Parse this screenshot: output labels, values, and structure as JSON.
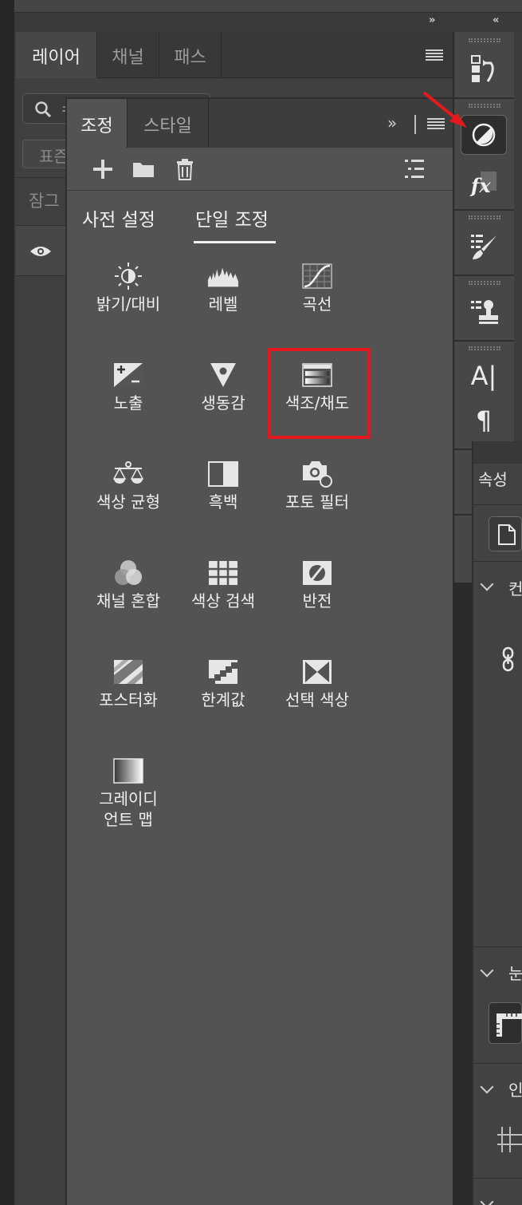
{
  "layers_panel": {
    "tabs": [
      "레이어",
      "채널",
      "패스"
    ],
    "search_partial": "ㅋ",
    "mode_partial": "표즌",
    "lock_partial": "잠그"
  },
  "top_collapse_glyph": "»",
  "adjustments_panel": {
    "tabs": [
      "조정",
      "스타일"
    ],
    "expand_glyph": "»",
    "subtabs": [
      "사전 설정",
      "단일 조정"
    ],
    "active_subtab": "단일 조정",
    "items": [
      {
        "label": "밝기/대비",
        "icon": "brightness-contrast-icon"
      },
      {
        "label": "레벨",
        "icon": "levels-icon"
      },
      {
        "label": "곡선",
        "icon": "curves-icon"
      },
      {
        "label": "노출",
        "icon": "exposure-icon"
      },
      {
        "label": "생동감",
        "icon": "vibrance-icon"
      },
      {
        "label": "색조/채도",
        "icon": "hue-saturation-icon"
      },
      {
        "label": "색상 균형",
        "icon": "color-balance-icon"
      },
      {
        "label": "흑백",
        "icon": "black-white-icon"
      },
      {
        "label": "포토 필터",
        "icon": "photo-filter-icon"
      },
      {
        "label": "채널 혼합",
        "icon": "channel-mixer-icon"
      },
      {
        "label": "색상 검색",
        "icon": "color-lookup-icon"
      },
      {
        "label": "반전",
        "icon": "invert-icon"
      },
      {
        "label": "포스터화",
        "icon": "posterize-icon"
      },
      {
        "label": "한계값",
        "icon": "threshold-icon"
      },
      {
        "label": "선택 색상",
        "icon": "selective-color-icon"
      },
      {
        "label": "그레이디\n언트 맵",
        "icon": "gradient-map-icon"
      }
    ],
    "highlighted_item": "색조/채도",
    "highlight_color": "#e5181d"
  },
  "toolstrip": {
    "collapse_glyph": "«",
    "tools": [
      "history-icon",
      "adjustments-icon",
      "styles-fx-icon",
      "brush-presets-icon",
      "clone-source-icon",
      "character-icon",
      "paragraph-icon"
    ],
    "character_label": "A|",
    "paragraph_label": "¶"
  },
  "properties_panel": {
    "tab_partial": "속성",
    "sections": [
      "컨",
      "눈",
      "인"
    ]
  },
  "annotation_arrow_color": "#e5181d"
}
